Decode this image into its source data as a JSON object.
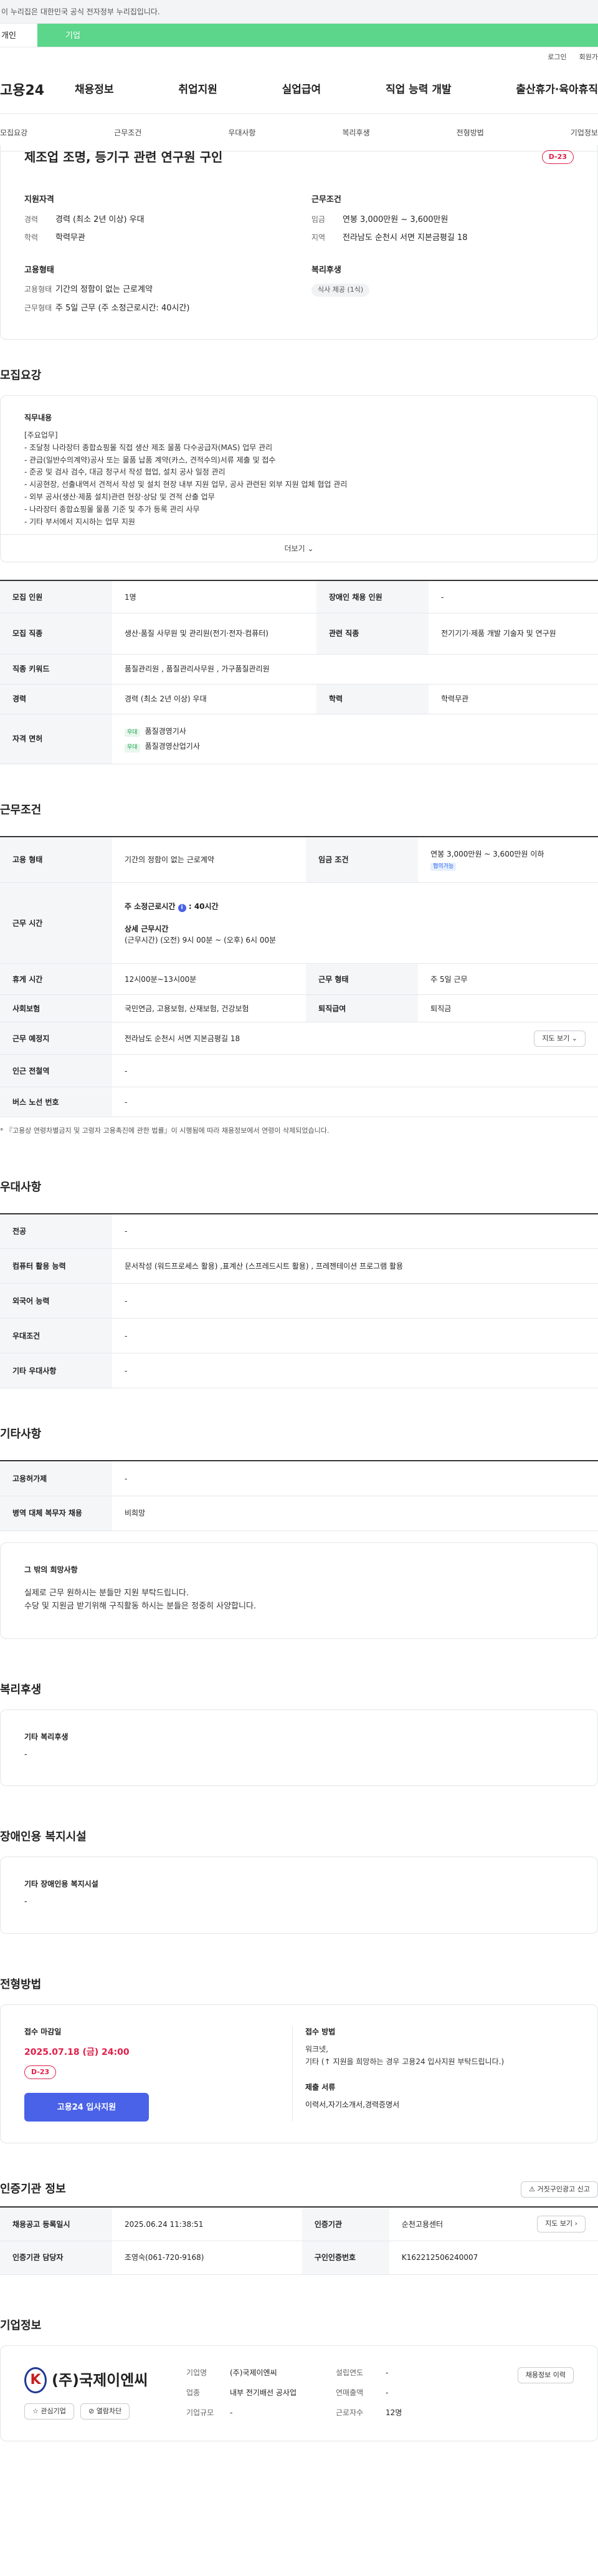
{
  "banner": {
    "text": "이 누리집은 대한민국 공식 전자정부 누리집입니다."
  },
  "toptabs": {
    "a": "개인",
    "b": "기업"
  },
  "util": {
    "login": "로그인",
    "join": "회원가"
  },
  "gnb": {
    "logo": "고용24",
    "menu": [
      "채용정보",
      "취업지원",
      "실업급여",
      "직업 능력 개발",
      "출산휴가·육아휴직"
    ]
  },
  "subnav": [
    "모집요강",
    "근무조건",
    "우대사항",
    "복리후생",
    "전형방법",
    "기업정보"
  ],
  "job": {
    "title": "제조업 조명, 등기구 관련 연구원 구인",
    "dday": "D-23",
    "qual_title": "지원자격",
    "career_k": "경력",
    "career_v": "경력 (최소 2년 이상) 우대",
    "edu_k": "학력",
    "edu_v": "학력무관",
    "cond_title": "근무조건",
    "wage_k": "임금",
    "wage_v": "연봉 3,000만원 ~ 3,600만원",
    "loc_k": "지역",
    "loc_v": "전라남도 순천시 서면 지본금평길 18",
    "emp_title": "고용형태",
    "emptype_k": "고용형태",
    "emptype_v": "기간의 정함이 없는 근로계약",
    "worktype_k": "근무형태",
    "worktype_v": "주 5일 근무 (주 소정근로시간: 40시간)",
    "welfare_title": "복리후생",
    "welfare_pill": "식사 제공 (1식)"
  },
  "recruit": {
    "title": "모집요강",
    "duty_title": "직무내용",
    "duty_text": "[주요업무]\n- 조달청 나라장터 종합쇼핑몰 직접 생산 제조 물품 다수공급자(MAS) 업무 관리\n- 관급(일반수의계약)공사 또는 물품 납품 계약(카스, 견적수의)서류 제출 및 접수\n- 준공 및 검사 검수, 대금 청구서 작성 협업, 설치 공사 일정 관리\n- 시공현장, 선출내역서 견적서 작성 및 설치 현장 내부 지원 업무, 공사 관련된 외부 지원 업체 협업 관리\n- 외부 공사(생산·제품 설치)관련 현장·상담 및 견적 산출 업무\n- 나라장터 종합쇼핑몰 물품 기준 및 추가 등록 관리 사무\n- 기타 부서에서 지시하는 업무 지원",
    "more": "더보기",
    "rows": {
      "count_k": "모집 인원",
      "count_v": "1명",
      "dis_k": "장애인 채용 인원",
      "dis_v": "-",
      "job_k": "모집 직종",
      "job_v": "생산·품질 사무원 및 관리원(전기·전자·컴퓨터)",
      "rel_k": "관련 직종",
      "rel_v": "전기기기·제품 개발 기술자 및 연구원",
      "kw_k": "직종 키워드",
      "kw_v": "품질관리원 , 품질관리사무원 , 가구품질관리원",
      "career_k": "경력",
      "career_v": "경력 (최소 2년 이상) 우대",
      "edu_k": "학력",
      "edu_v": "학력무관",
      "lic_k": "자격 면허",
      "lic_tag": "우대",
      "lic1": "품질경영기사",
      "lic2": "품질경영산업기사"
    }
  },
  "work": {
    "title": "근무조건",
    "emp_k": "고용 형태",
    "emp_v": "기간의 정함이 없는 근로계약",
    "wage_k": "임금 조건",
    "wage_v": "연봉 3,000만원 ~ 3,600만원 이하",
    "wage_tag": "협의가능",
    "hours_k": "근무 시간",
    "hours_main": "주 소정근로시간",
    "hours_val": ": 40시간",
    "hours_detail_t": "상세 근무시간",
    "hours_detail": "(근무시간) (오전) 9시 00분 ~ (오후) 6시 00분",
    "rest_k": "휴게 시간",
    "rest_v": "12시00분~13시00분",
    "form_k": "근무 형태",
    "form_v": "주 5일 근무",
    "ins_k": "사회보험",
    "ins_v": "국민연금, 고용보험, 산재보험, 건강보험",
    "ret_k": "퇴직급여",
    "ret_v": "퇴직금",
    "place_k": "근무 예정지",
    "place_v": "전라남도 순천시 서면 지본금평길 18",
    "map_btn": "지도 보기",
    "sub_k": "인근 전철역",
    "sub_v": "-",
    "bus_k": "버스 노선 번호",
    "bus_v": "-",
    "note": "* 『고용상 연령차별금지 및 고령자 고용촉진에 관한 법률』이 시행됨에 따라 채용정보에서 연령이 삭제되었습니다."
  },
  "pref": {
    "title": "우대사항",
    "major_k": "전공",
    "major_v": "-",
    "pc_k": "컴퓨터 활용 능력",
    "pc_v": "문서작성 (워드프로세스 활용) ,표계산 (스프레드시트 활용) , 프레젠테이션 프로그램 활용",
    "lang_k": "외국어 능력",
    "lang_v": "-",
    "cond_k": "우대조건",
    "cond_v": "-",
    "etc_k": "기타 우대사항",
    "etc_v": "-"
  },
  "etc": {
    "title": "기타사항",
    "hire_k": "고용허가제",
    "hire_v": "-",
    "mil_k": "병역 대체 복무자 채용",
    "mil_v": "비희망",
    "wish_title": "그 밖의 희망사항",
    "wish_text": "실제로 근무 원하시는 분들만 지원 부탁드립니다.\n수당 및 지원금 받기위해 구직활동 하시는 분들은 정중히 사양합니다."
  },
  "welfare": {
    "title": "복리후생",
    "sub": "기타 복리후생",
    "val": "-"
  },
  "disab": {
    "title": "장애인용 복지시설",
    "sub": "기타 장애인용 복지시설",
    "val": "-"
  },
  "apply": {
    "title": "전형방법",
    "deadline_t": "접수 마감일",
    "deadline": "2025.07.18 (금) 24:00",
    "dday": "D-23",
    "btn": "고용24 입사지원",
    "method_t": "접수 방법",
    "method_v": "워크넷,\n기타 (↑ 지원을 희망하는 경우 고용24 입사지원 부탁드립니다.)",
    "docs_t": "제출 서류",
    "docs_v": "이력서,자기소개서,경력증명서"
  },
  "cert": {
    "title": "인증기관 정보",
    "report_btn": "거짓구인광고 신고",
    "reg_k": "채용공고 등록일시",
    "reg_v": "2025.06.24 11:38:51",
    "org_k": "인증기관",
    "org_v": "순천고용센터",
    "map_btn": "지도 보기",
    "staff_k": "인증기관 담당자",
    "staff_v": "조영숙(061-720-9168)",
    "no_k": "구인인증번호",
    "no_v": "K162212506240007"
  },
  "company": {
    "title": "기업정보",
    "name": "(주)국제이엔씨",
    "fav": "관심기업",
    "block": "열람차단",
    "name_k": "기업명",
    "name_v": "(주)국제이엔씨",
    "est_k": "설립연도",
    "est_v": "-",
    "ind_k": "업종",
    "ind_v": "내부 전기배선 공사업",
    "sales_k": "연매출액",
    "sales_v": "-",
    "emp_k": "근로자수",
    "emp_v": "12명",
    "size_k": "기업규모",
    "size_v": "-",
    "btn": "채용정보 이력"
  }
}
